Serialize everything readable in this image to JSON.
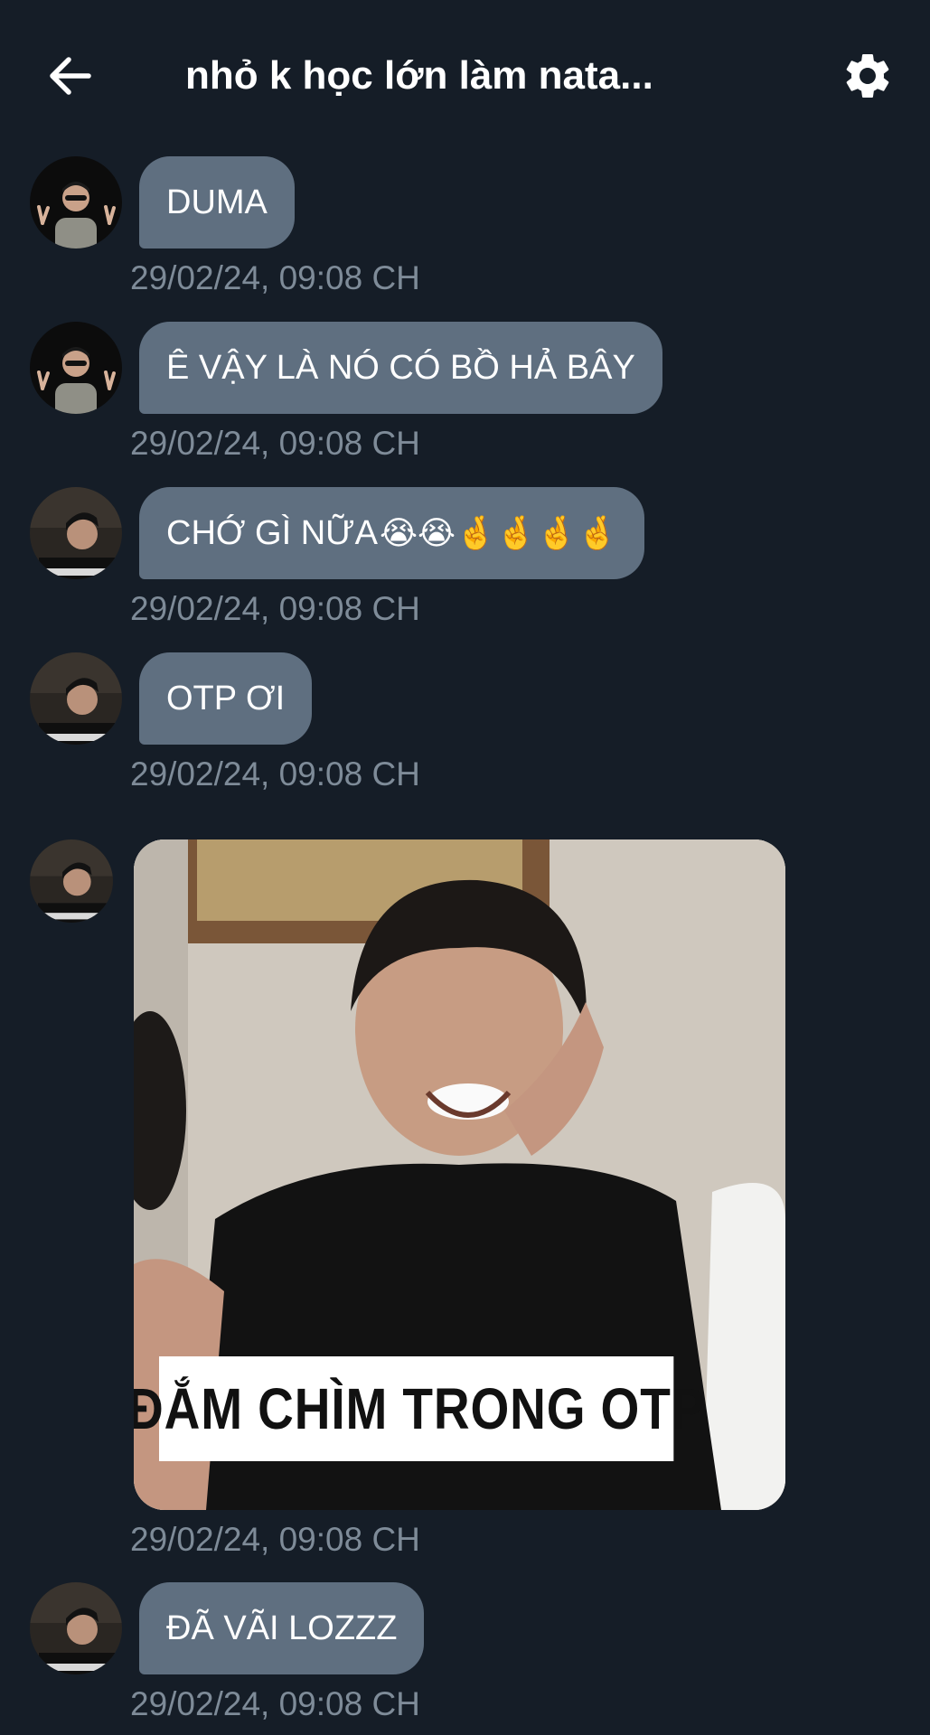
{
  "header": {
    "title": "nhỏ k học lớn làm nata...",
    "back_icon": "arrow-left-icon",
    "settings_icon": "gear-icon"
  },
  "colors": {
    "background": "#151d27",
    "bubble": "#5f6f80",
    "timestamp": "#7e8b98"
  },
  "messages": [
    {
      "text": "DUMA",
      "time": "29/02/24, 09:08 CH",
      "sender": "user-a"
    },
    {
      "text": "Ê VẬY LÀ NÓ CÓ BỒ HẢ BÂY",
      "time": "29/02/24, 09:08 CH",
      "sender": "user-a"
    },
    {
      "text": "CHỚ GÌ NỮA",
      "emojis": "😭😭🤞🤞🤞🤞",
      "time": "29/02/24, 09:08 CH",
      "sender": "user-b"
    },
    {
      "text": "OTP ƠI",
      "time": "29/02/24, 09:08 CH",
      "sender": "user-b"
    },
    {
      "image_caption": "ĐẮM CHÌM TRONG OTP",
      "time": "29/02/24, 09:08 CH",
      "sender": "user-b"
    },
    {
      "text": "ĐÃ VÃI LOZZZ",
      "time": "29/02/24, 09:08 CH",
      "sender": "user-b"
    }
  ]
}
